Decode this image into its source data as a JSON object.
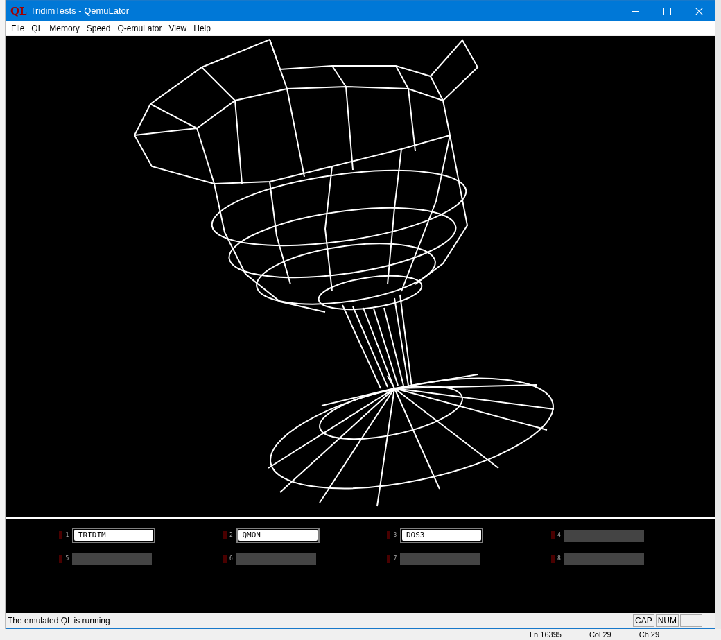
{
  "window": {
    "logo": "QL",
    "title": "TridimTests - QemuLator"
  },
  "menu": [
    "File",
    "QL",
    "Memory",
    "Speed",
    "Q-emuLator",
    "View",
    "Help"
  ],
  "drives": [
    {
      "number": "1",
      "name": "TRIDIM",
      "filled": true
    },
    {
      "number": "2",
      "name": "QMON",
      "filled": true
    },
    {
      "number": "3",
      "name": "DOS3",
      "filled": true
    },
    {
      "number": "4",
      "filled": false
    },
    {
      "number": "5",
      "filled": false
    },
    {
      "number": "6",
      "filled": false
    },
    {
      "number": "7",
      "filled": false
    },
    {
      "number": "8",
      "filled": false
    }
  ],
  "status_bar": {
    "message": "The emulated QL is running",
    "indicators": [
      "CAP",
      "NUM"
    ]
  },
  "background_status_bar": [
    "Ln 16395",
    "Col 29",
    "Ch 29"
  ]
}
